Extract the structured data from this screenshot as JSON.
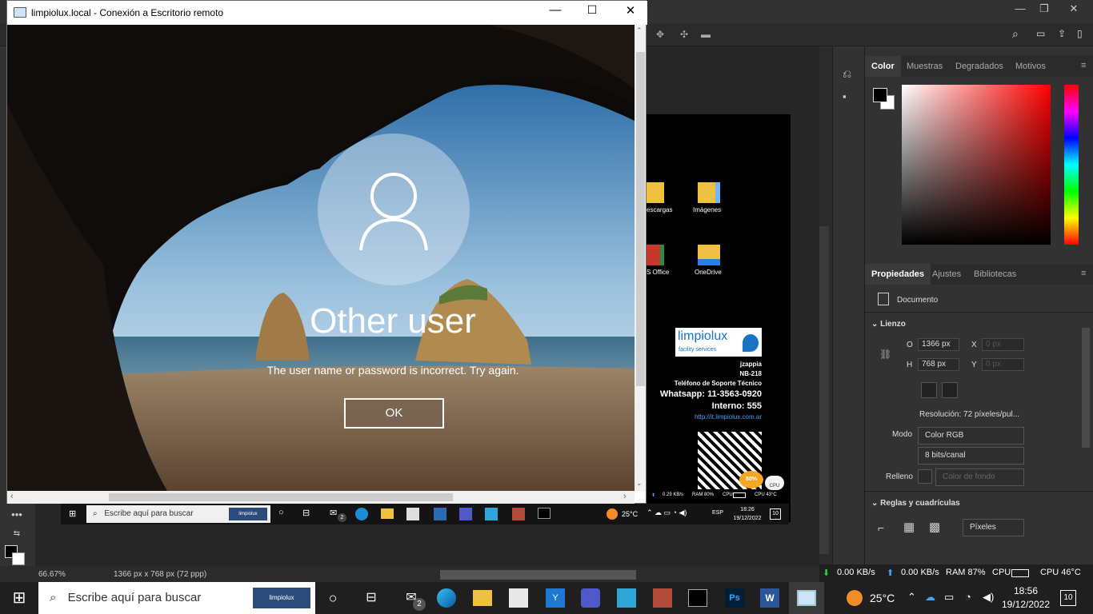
{
  "rdp": {
    "title": "limpiolux.local - Conexión a Escritorio remoto",
    "lock": {
      "user_name": "Other user",
      "message": "The user name or password is incorrect. Try again.",
      "ok_label": "OK"
    }
  },
  "remote_desktop": {
    "icons": [
      {
        "label": "escargas",
        "name": "descargas-folder-icon"
      },
      {
        "label": "Imágenes",
        "name": "imagenes-folder-icon"
      },
      {
        "label": "S Office",
        "name": "office-folder-icon"
      },
      {
        "label": "OneDrive",
        "name": "onedrive-folder-icon"
      }
    ],
    "brand": "limpiolux",
    "brand_sub": "facility services",
    "info": {
      "user": "jzappia",
      "host": "NB-218",
      "support": "Teléfono de Soporte Técnico",
      "whatsapp": "Whatsapp: 11-3563-0920",
      "interno": "Interno: 555",
      "url": "http://it.limpiolux.com.ar"
    },
    "cpu_badge": "80%",
    "cpu_badge_label": "CPU",
    "stats": {
      "up": "0.29 KB/s",
      "ram": "RAM 80%",
      "cpu": "CPU",
      "cpu_temp": "CPU 43°C"
    },
    "taskbar": {
      "search_placeholder": "Escribe aquí para buscar",
      "mail_badge": "2",
      "temp": "25°C",
      "lang": "ESP",
      "time": "18:26",
      "date": "19/12/2022",
      "notif": "10"
    }
  },
  "photoshop": {
    "color_tabs": [
      "Color",
      "Muestras",
      "Degradados",
      "Motivos"
    ],
    "prop_tabs": [
      "Propiedades",
      "Ajustes",
      "Bibliotecas"
    ],
    "doc_label": "Documento",
    "lienzo": "Lienzo",
    "width_label": "O",
    "width_value": "1366 px",
    "height_label": "H",
    "height_value": "768 px",
    "x_label": "X",
    "x_placeholder": "0 px",
    "y_label": "Y",
    "y_placeholder": "0 px",
    "resolution": "Resolución: 72 píxeles/pul...",
    "mode_label": "Modo",
    "mode_value": "Color RGB",
    "bits_value": "8 bits/canal",
    "fill_label": "Relleno",
    "fill_value": "Color de fondo",
    "rulers": "Reglas y cuadrículas",
    "units_value": "Píxeles",
    "zoom": "66.67%",
    "doc_info": "1366 px x 768 px (72 ppp)",
    "net_down": "0.00 KB/s",
    "net_up": "0.00 KB/s",
    "ram": "RAM 87%",
    "cpu": "CPU",
    "cpu_temp": "CPU 46°C"
  },
  "taskbar": {
    "search_placeholder": "Escribe aquí para buscar",
    "mail_badge": "2",
    "temp": "25°C",
    "time": "18:56",
    "date": "19/12/2022",
    "notif": "10"
  },
  "colors": {
    "ps_bg": "#323232",
    "taskbar": "#1f1f1f",
    "accent_blue": "#0a6fc2",
    "ps_red": "#ff0000"
  }
}
